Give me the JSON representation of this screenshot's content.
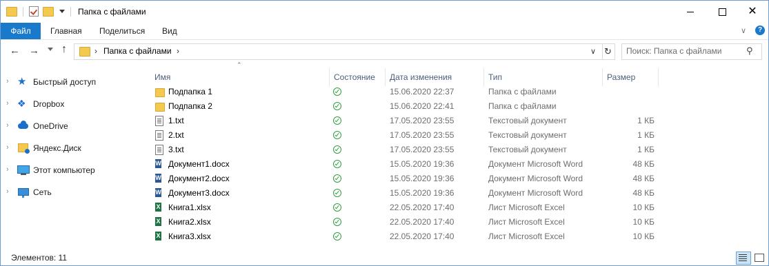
{
  "window": {
    "title": "Папка с файлами",
    "close_glyph": "✕"
  },
  "ribbon": {
    "tabs": [
      "Файл",
      "Главная",
      "Поделиться",
      "Вид"
    ],
    "help": "?"
  },
  "address": {
    "path": "Папка с файлами",
    "separator": "›"
  },
  "search": {
    "placeholder": "Поиск: Папка с файлами"
  },
  "nav_pane": {
    "items": [
      {
        "label": "Быстрый доступ",
        "icon": "star-icon"
      },
      {
        "label": "Dropbox",
        "icon": "dropbox-icon"
      },
      {
        "label": "OneDrive",
        "icon": "onedrive-cloud-icon"
      },
      {
        "label": "Яндекс.Диск",
        "icon": "yandex-disk-icon"
      },
      {
        "label": "Этот компьютер",
        "icon": "computer-icon"
      },
      {
        "label": "Сеть",
        "icon": "network-icon"
      }
    ]
  },
  "columns": {
    "name": "Имя",
    "status": "Состояние",
    "date": "Дата изменения",
    "type": "Тип",
    "size": "Размер"
  },
  "files": [
    {
      "name": "Подпапка 1",
      "kind": "folder",
      "date": "15.06.2020 22:37",
      "type": "Папка с файлами",
      "size": ""
    },
    {
      "name": "Подпапка 2",
      "kind": "folder",
      "date": "15.06.2020 22:41",
      "type": "Папка с файлами",
      "size": ""
    },
    {
      "name": "1.txt",
      "kind": "txt",
      "date": "17.05.2020 23:55",
      "type": "Текстовый документ",
      "size": "1 КБ"
    },
    {
      "name": "2.txt",
      "kind": "txt",
      "date": "17.05.2020 23:55",
      "type": "Текстовый документ",
      "size": "1 КБ"
    },
    {
      "name": "3.txt",
      "kind": "txt",
      "date": "17.05.2020 23:55",
      "type": "Текстовый документ",
      "size": "1 КБ"
    },
    {
      "name": "Документ1.docx",
      "kind": "word",
      "date": "15.05.2020 19:36",
      "type": "Документ Microsoft Word",
      "size": "48 КБ"
    },
    {
      "name": "Документ2.docx",
      "kind": "word",
      "date": "15.05.2020 19:36",
      "type": "Документ Microsoft Word",
      "size": "48 КБ"
    },
    {
      "name": "Документ3.docx",
      "kind": "word",
      "date": "15.05.2020 19:36",
      "type": "Документ Microsoft Word",
      "size": "48 КБ"
    },
    {
      "name": "Книга1.xlsx",
      "kind": "excel",
      "date": "22.05.2020 17:40",
      "type": "Лист Microsoft Excel",
      "size": "10 КБ"
    },
    {
      "name": "Книга2.xlsx",
      "kind": "excel",
      "date": "22.05.2020 17:40",
      "type": "Лист Microsoft Excel",
      "size": "10 КБ"
    },
    {
      "name": "Книга3.xlsx",
      "kind": "excel",
      "date": "22.05.2020 17:40",
      "type": "Лист Microsoft Excel",
      "size": "10 КБ"
    }
  ],
  "status_bar": {
    "count": "Элементов: 11"
  },
  "colors": {
    "accent": "#1979ca",
    "synced": "#2e9e3e",
    "folder": "#f3c94f"
  }
}
